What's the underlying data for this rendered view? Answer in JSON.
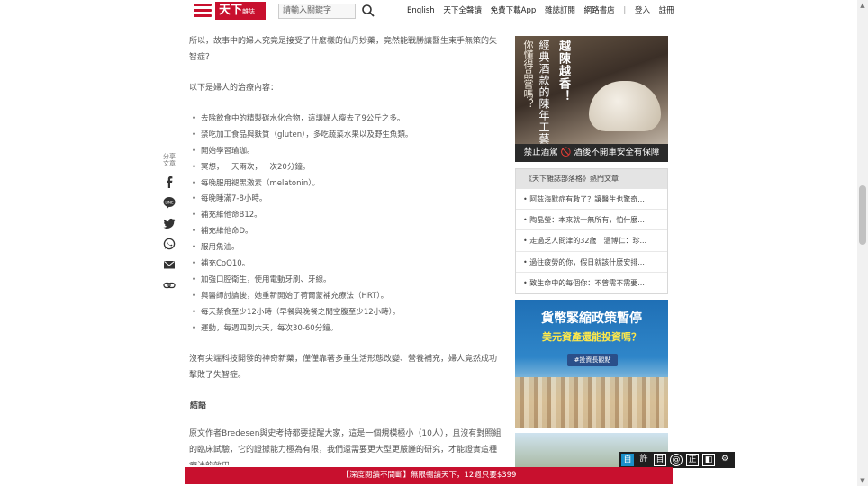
{
  "header": {
    "logo_text": "天下",
    "logo_sub": "雜誌",
    "search_placeholder": "請輸入關鍵字",
    "nav": [
      "English",
      "天下全聲讀",
      "免費下載App",
      "雜誌訂閱",
      "網路書店",
      "|",
      "登入",
      "註冊"
    ]
  },
  "article": {
    "intro": "所以，故事中的婦人究竟是接受了什麼樣的仙丹妙藥，竟然能戰勝讓醫生束手無策的失智症？",
    "treatment_intro": "以下是婦人的治療內容：",
    "treatments": [
      "去除飲食中的精製碳水化合物，這讓婦人瘦去了9公斤之多。",
      "禁吃加工食品與麩質（gluten），多吃蔬菜水果以及野生魚類。",
      "開始學習瑜珈。",
      "冥想，一天兩次，一次20分鐘。",
      "每晚服用褪黑激素（melatonin）。",
      "每晚睡滿7-8小時。",
      "補充維他命B12。",
      "補充維他命D。",
      "服用魚油。",
      "補充CoQ10。",
      "加強口腔衛生，使用電動牙刷、牙線。",
      "與醫師討論後，她重新開始了荷爾蒙補充療法（HRT）。",
      "每天禁食至少12小時（早餐與晚餐之間空腹至少12小時）。",
      "運動，每週四到六天，每次30-60分鐘。"
    ],
    "result": "沒有尖端科技開發的神奇新藥，僅僅靠著多重生活形態改變、營養補充，婦人竟然成功擊敗了失智症。",
    "conclusion_heading": "結語",
    "conclusion": "原文作者Bredesen與史考特都要提醒大家，這是一個規模極小（10人），且沒有對照組的臨床試驗，它的證據能力極為有限，我們還需要更大型更嚴謹的研究，才能證實這種療法的效用。"
  },
  "share": {
    "label": "分享文章",
    "icons": [
      "facebook-icon",
      "line-icon",
      "twitter-icon",
      "whatsapp-icon",
      "email-icon",
      "link-icon"
    ]
  },
  "sidebar": {
    "ad1": {
      "title_a": "越陳越香！",
      "title_b": "經典酒款的陳年工藝，",
      "title_c": "你懂得品嘗嗎？",
      "footer": "禁止酒駕 🚫 酒後不開車安全有保障"
    },
    "hot": {
      "heading": "《天下雜誌部落格》熱門文章",
      "items": [
        "阿茲海默症有救了？讓醫生也驚奇...",
        "陶晶瑩：本來就一無所有，怕什麼...",
        "走過乏人問津的32歲　溫博仁：珍...",
        "過往疲勞的你，假日就該什麼安排...",
        "致生命中的每個你：不曾需不需要..."
      ]
    },
    "ad2": {
      "line1": "貨幣緊縮政策暫停",
      "line2": "美元資產還能投資嗎？",
      "tag": "#投資長觀點"
    }
  },
  "toolbar": {
    "buttons": [
      "自",
      "許",
      "目",
      "@",
      "正",
      "◧",
      "⚙"
    ]
  },
  "banner": {
    "text": "【深度閱讀不間斷】無限暢讀天下，12週只要$399"
  },
  "colors": {
    "brand_red": "#c8102e",
    "ad_blue": "#1f6fb5"
  }
}
